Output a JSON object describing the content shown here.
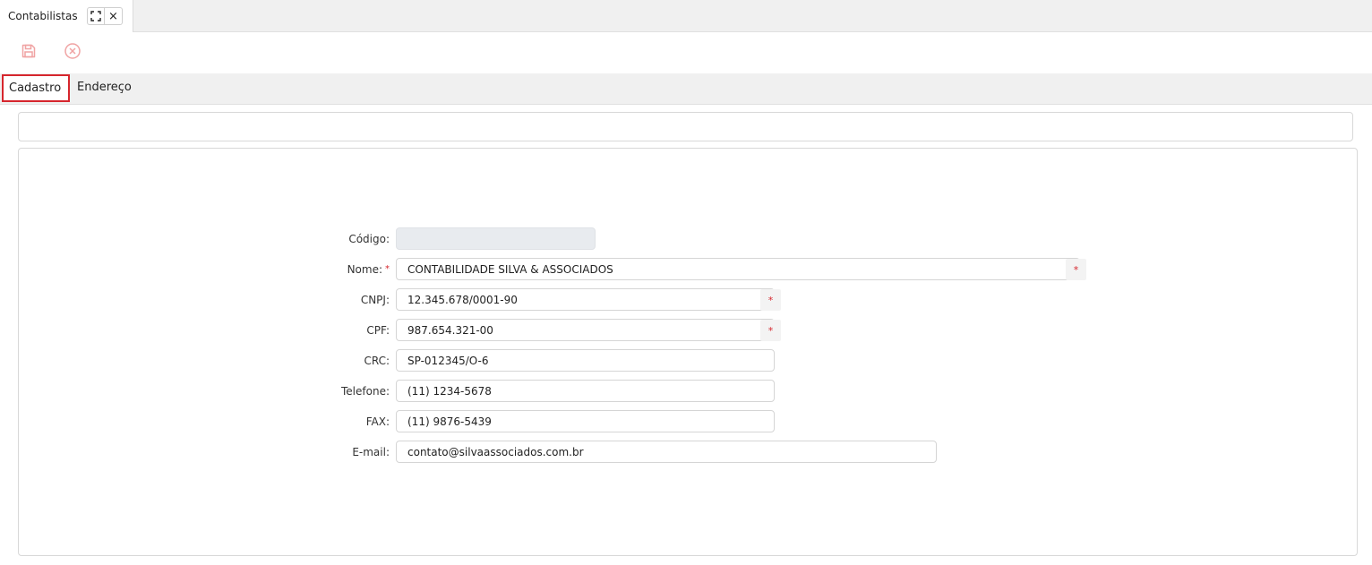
{
  "window_tab": {
    "title": "Contabilistas",
    "expand_icon": "expand-icon",
    "close_icon": "×"
  },
  "toolbar": {
    "save_icon": "floppy-disk-icon",
    "cancel_icon": "circle-x-icon",
    "icon_color": "#f0a3a3"
  },
  "subtabs": {
    "cadastro": "Cadastro",
    "endereco": "Endereço"
  },
  "form": {
    "codigo": {
      "label": "Código:",
      "value": ""
    },
    "nome": {
      "label": "Nome:",
      "required_mark": "*",
      "value": "CONTABILIDADE SILVA & ASSOCIADOS",
      "badge": "*"
    },
    "cnpj": {
      "label": "CNPJ:",
      "value": "12.345.678/0001-90",
      "badge": "*"
    },
    "cpf": {
      "label": "CPF:",
      "value": "987.654.321-00",
      "badge": "*"
    },
    "crc": {
      "label": "CRC:",
      "value": "SP-012345/O-6"
    },
    "telefone": {
      "label": "Telefone:",
      "value": "(11) 1234-5678"
    },
    "fax": {
      "label": "FAX:",
      "value": "(11) 9876-5439"
    },
    "email": {
      "label": "E-mail:",
      "value": "contato@silvaassociados.com.br"
    }
  },
  "colors": {
    "accent_red": "#d6262d",
    "tab_bg": "#f0f0f0"
  }
}
